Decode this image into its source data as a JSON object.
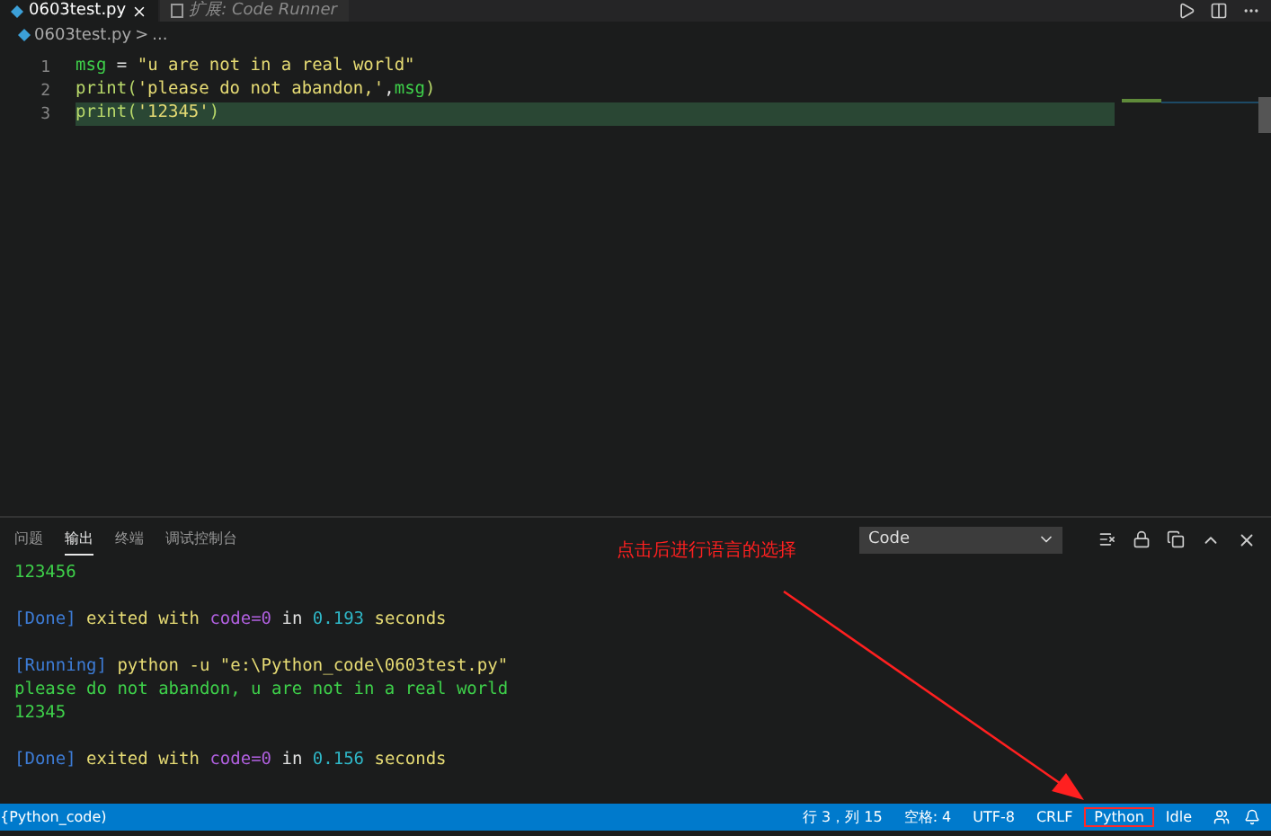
{
  "editor_tabs": [
    {
      "label": "0603test.py",
      "selected": true,
      "italic": false
    },
    {
      "label": "扩展: Code Runner",
      "selected": false,
      "italic": true
    }
  ],
  "breadcrumb": {
    "file": "0603test.py",
    "separator": ">",
    "more": "..."
  },
  "code_lines": [
    {
      "number": "1",
      "highlighted": false,
      "tokens": [
        {
          "text": "msg",
          "kind": "var"
        },
        {
          "text": " = ",
          "kind": "plain"
        },
        {
          "text": "\"u are not in a real world\"",
          "kind": "string"
        }
      ]
    },
    {
      "number": "2",
      "highlighted": false,
      "tokens": [
        {
          "text": "print(",
          "kind": "func"
        },
        {
          "text": "'please do not abandon,'",
          "kind": "string"
        },
        {
          "text": ",",
          "kind": "plain"
        },
        {
          "text": "msg",
          "kind": "var"
        },
        {
          "text": ")",
          "kind": "func"
        }
      ]
    },
    {
      "number": "3",
      "highlighted": true,
      "tokens": [
        {
          "text": "print(",
          "kind": "func"
        },
        {
          "text": "'12345'",
          "kind": "string"
        },
        {
          "text": ")",
          "kind": "func"
        }
      ]
    }
  ],
  "panel_tabs": [
    {
      "label": "问题",
      "selected": false
    },
    {
      "label": "输出",
      "selected": true
    },
    {
      "label": "终端",
      "selected": false
    },
    {
      "label": "调试控制台",
      "selected": false
    }
  ],
  "output_select": {
    "value": "Code"
  },
  "output_lines": [
    {
      "kind": "text",
      "tokens": [
        {
          "text": "123456",
          "kind": "out"
        }
      ]
    },
    {
      "kind": "blank"
    },
    {
      "tokens": [
        {
          "text": "[Done]",
          "kind": "tag"
        },
        {
          "text": " exited with ",
          "kind": "cmd"
        },
        {
          "text": "code=0",
          "kind": "code"
        },
        {
          "text": " in ",
          "kind": "plain"
        },
        {
          "text": "0.193",
          "kind": "num"
        },
        {
          "text": " seconds",
          "kind": "cmd"
        }
      ]
    },
    {
      "kind": "blank"
    },
    {
      "tokens": [
        {
          "text": "[Running]",
          "kind": "tag"
        },
        {
          "text": " python -u \"e:\\Python_code\\0603test.py\"",
          "kind": "cmd"
        }
      ]
    },
    {
      "tokens": [
        {
          "text": "please do not abandon, u are not in a real world",
          "kind": "out"
        }
      ]
    },
    {
      "tokens": [
        {
          "text": "12345",
          "kind": "out"
        }
      ]
    },
    {
      "kind": "blank"
    },
    {
      "tokens": [
        {
          "text": "[Done]",
          "kind": "tag"
        },
        {
          "text": " exited with ",
          "kind": "cmd"
        },
        {
          "text": "code=0",
          "kind": "code"
        },
        {
          "text": " in ",
          "kind": "plain"
        },
        {
          "text": "0.156",
          "kind": "num"
        },
        {
          "text": " seconds",
          "kind": "cmd"
        }
      ]
    }
  ],
  "annotation": {
    "text": "点击后进行语言的选择"
  },
  "status_bar": {
    "left": "{Python_code)",
    "items": [
      {
        "text": "行 3，列 15",
        "boxed": false
      },
      {
        "text": "空格: 4",
        "boxed": false
      },
      {
        "text": "UTF-8",
        "boxed": false
      },
      {
        "text": "CRLF",
        "boxed": false
      },
      {
        "text": "Python",
        "boxed": true
      },
      {
        "text": "Idle",
        "boxed": false
      }
    ]
  }
}
